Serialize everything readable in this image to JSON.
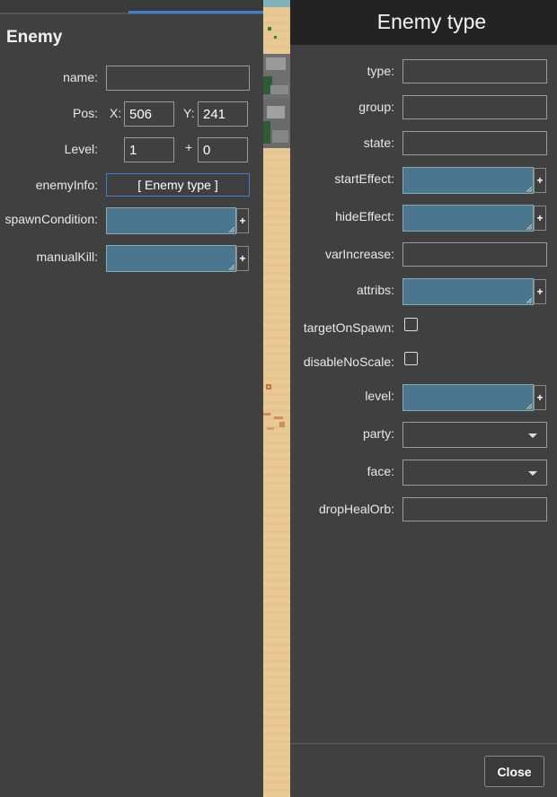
{
  "left": {
    "title": "Enemy",
    "labels": {
      "name": "name:",
      "pos": "Pos:",
      "x": "X:",
      "y": "Y:",
      "level": "Level:",
      "plus": "+",
      "enemy_info": "enemyInfo:",
      "spawn_condition": "spawnCondition:",
      "manual_kill": "manualKill:"
    },
    "values": {
      "name": "",
      "pos_x": "506",
      "pos_y": "241",
      "level": "1",
      "level_offset": "0"
    },
    "enemy_info_button": "[ Enemy type ]",
    "add_label": "+"
  },
  "dialog": {
    "title": "Enemy type",
    "labels": {
      "type": "type:",
      "group": "group:",
      "state": "state:",
      "start_effect": "startEffect:",
      "hide_effect": "hideEffect:",
      "var_increase": "varIncrease:",
      "attribs": "attribs:",
      "target_on_spawn": "targetOnSpawn:",
      "disable_no_scale": "disableNoScale:",
      "level": "level:",
      "party": "party:",
      "face": "face:",
      "drop_heal_orb": "dropHealOrb:"
    },
    "add_label": "+",
    "close_label": "Close"
  },
  "colors": {
    "panel_bg": "#404040",
    "header_bg": "#232323",
    "accent_tab": "#3f7fd6",
    "json_field_bg": "#4b7690",
    "sand": "#e8c994"
  }
}
